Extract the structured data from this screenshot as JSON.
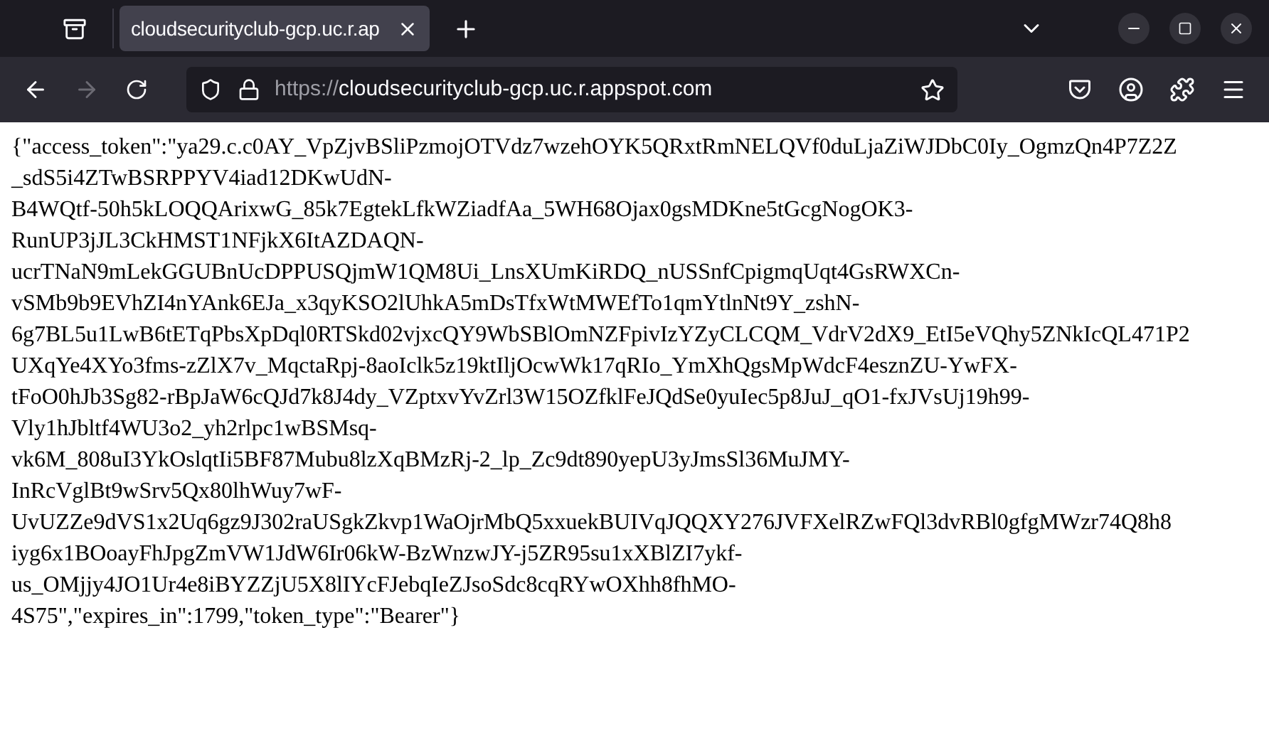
{
  "tabs": [
    {
      "title": "cloudsecurityclub-gcp.uc.r.ap",
      "selected": true
    }
  ],
  "navigation": {
    "back_disabled": false,
    "forward_disabled": true
  },
  "address_bar": {
    "scheme": "https://",
    "host": "cloudsecurityclub-gcp.uc.r.appspot.com"
  },
  "page_lines": [
    "{\"access_token\":\"ya29.c.c0AY_VpZjvBSliPzmojOTVdz7wzehOYK5QRxtRmNELQVf0duLjaZiWJDbC0Iy_OgmzQn4P7Z2Z",
    "_sdS5i4ZTwBSRPPYV4iad12DKwUdN-",
    "B4WQtf-50h5kLOQQArixwG_85k7EgtekLfkWZiadfAa_5WH68Ojax0gsMDKne5tGcgNogOK3-",
    "RunUP3jJL3CkHMST1NFjkX6ItAZDAQN-",
    "ucrTNaN9mLekGGUBnUcDPPUSQjmW1QM8Ui_LnsXUmKiRDQ_nUSSnfCpigmqUqt4GsRWXCn-",
    "vSMb9b9EVhZI4nYAnk6EJa_x3qyKSO2lUhkA5mDsTfxWtMWEfTo1qmYtlnNt9Y_zshN-",
    "6g7BL5u1LwB6tETqPbsXpDql0RTSkd02vjxcQY9WbSBlOmNZFpivIzYZyCLCQM_VdrV2dX9_EtI5eVQhy5ZNkIcQL471P2",
    "UXqYe4XYo3fms-zZlX7v_MqctaRpj-8aoIclk5z19ktIljOcwWk17qRIo_YmXhQgsMpWdcF4esznZU-YwFX-",
    "tFoO0hJb3Sg82-rBpJaW6cQJd7k8J4dy_VZptxvYvZrl3W15OZfklFeJQdSe0yuIec5p8JuJ_qO1-fxJVsUj19h99-",
    "Vly1hJbltf4WU3o2_yh2rlpc1wBSMsq-",
    "vk6M_808uI3YkOslqtIi5BF87Mubu8lzXqBMzRj-2_lp_Zc9dt890yepU3yJmsSl36MuJMY-",
    "InRcVglBt9wSrv5Qx80lhWuy7wF-",
    "UvUZZe9dVS1x2Uq6gz9J302raUSgkZkvp1WaOjrMbQ5xxuekBUIVqJQQXY276JVFXelRZwFQl3dvRBl0gfgMWzr74Q8h8",
    "iyg6x1BOoayFhJpgZmVW1JdW6Ir06kW-BzWnzwJY-j5ZR95su1xXBlZI7ykf-",
    "us_OMjjy4JO1Ur4e8iBYZZjU5X8lIYcFJebqIeZJsoSdc8cqRYwOXhh8fhMO-",
    "4S75\",\"expires_in\":1799,\"token_type\":\"Bearer\"}"
  ]
}
